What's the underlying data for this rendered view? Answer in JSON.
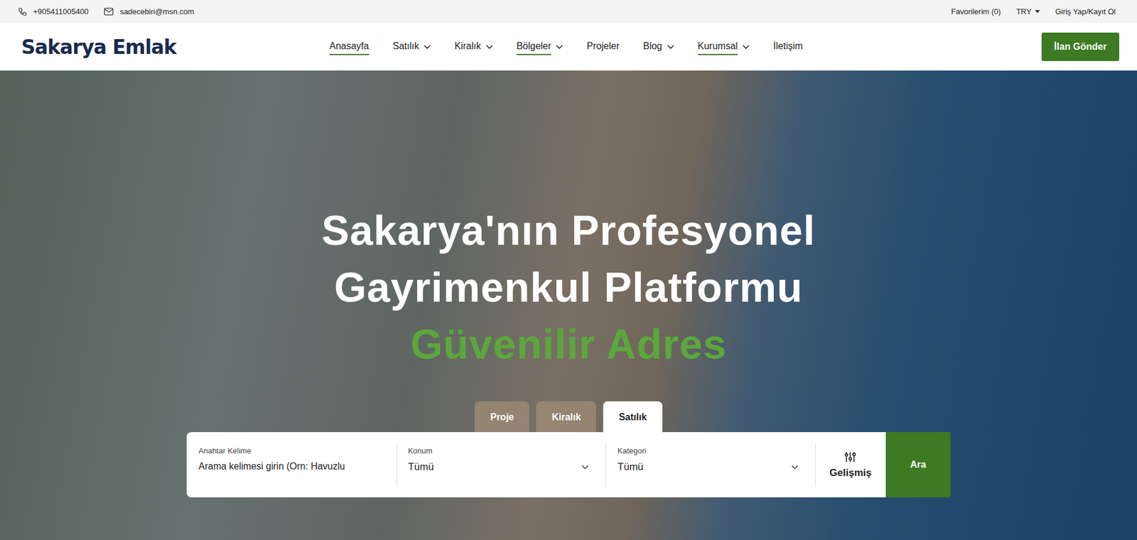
{
  "topbar": {
    "phone": "+905411005400",
    "email": "sadecebiri@msn.com",
    "favorites": "Favorilerim (0)",
    "currency": "TRY",
    "login": "Giriş Yap/Kayıt Ol"
  },
  "logo": "Sakarya Emlak",
  "nav": [
    {
      "label": "Anasayfa",
      "dropdown": false,
      "active": true
    },
    {
      "label": "Satılık",
      "dropdown": true,
      "active": false
    },
    {
      "label": "Kiralık",
      "dropdown": true,
      "active": false
    },
    {
      "label": "Bölgeler",
      "dropdown": true,
      "active": true
    },
    {
      "label": "Projeler",
      "dropdown": false,
      "active": false
    },
    {
      "label": "Blog",
      "dropdown": true,
      "active": false
    },
    {
      "label": "Kurumsal",
      "dropdown": true,
      "active": true
    },
    {
      "label": "İletişim",
      "dropdown": false,
      "active": false
    }
  ],
  "cta": "İlan Gönder",
  "hero": {
    "title_lines": [
      "Sakarya'nın Profesyonel",
      "Gayrimenkul Platformu"
    ],
    "highlight": "Güvenilir Adres"
  },
  "search_tabs": [
    {
      "label": "Proje",
      "selected": false
    },
    {
      "label": "Kiralık",
      "selected": false
    },
    {
      "label": "Satılık",
      "selected": true
    }
  ],
  "search": {
    "fields": [
      {
        "label": "Anahtar Kelime",
        "kind": "input",
        "value": "Arama kelimesi girin (Orn: Havuzlu"
      },
      {
        "label": "Konum",
        "kind": "select",
        "value": "Tümü"
      },
      {
        "label": "Kategori",
        "kind": "select",
        "value": "Tümü"
      }
    ],
    "advanced": "Gelişmiş",
    "submit": "Ara"
  }
}
